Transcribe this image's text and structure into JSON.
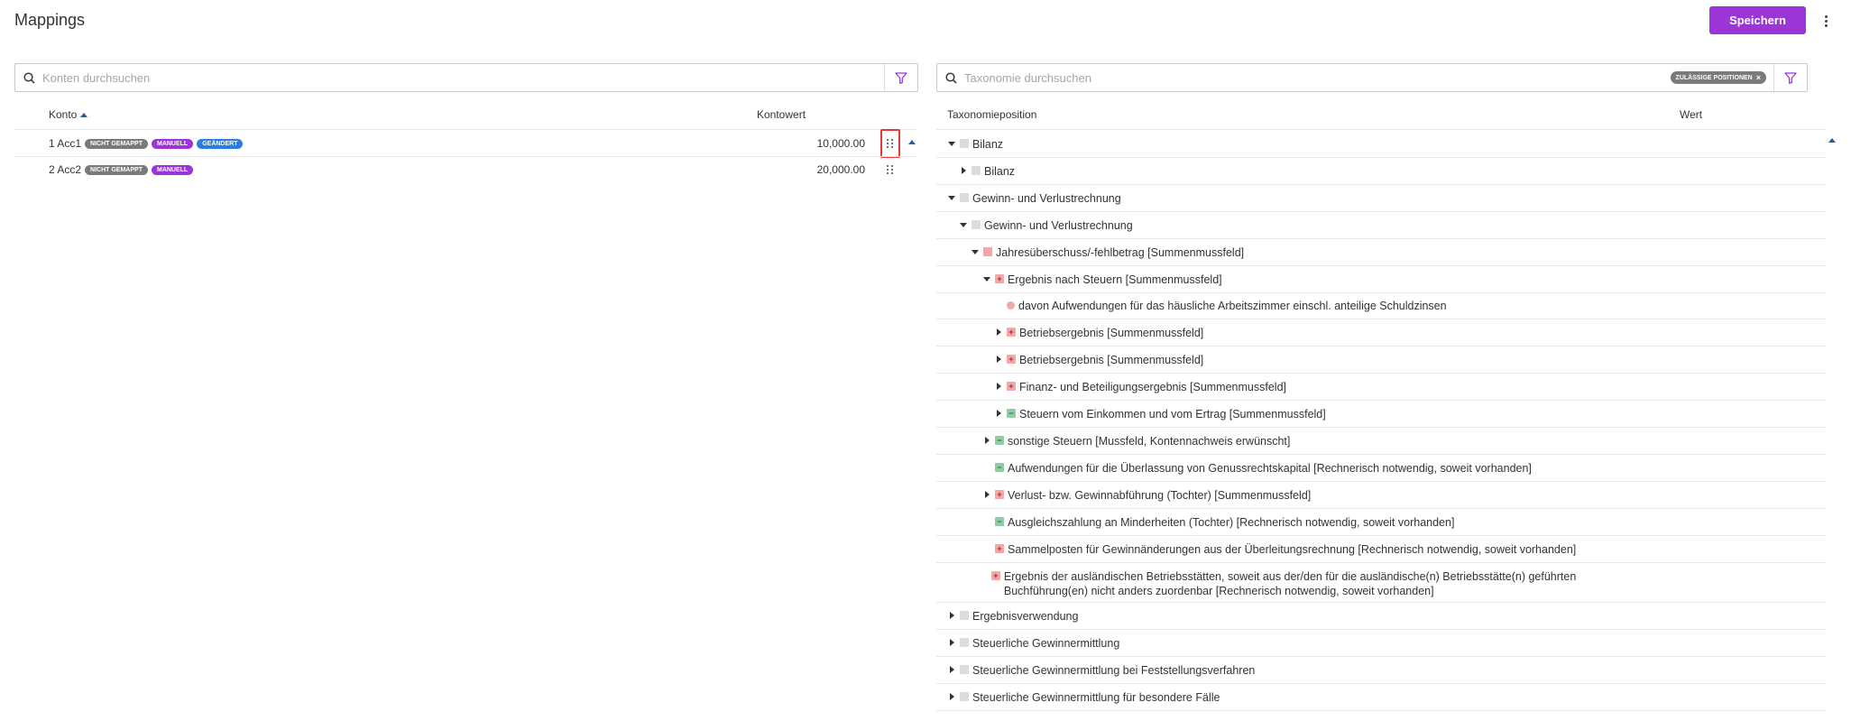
{
  "header": {
    "title": "Mappings",
    "save_label": "Speichern",
    "more_icon": "more-vertical-icon"
  },
  "colors": {
    "accent": "#9b35d8",
    "badge_grey": "#7a7a7a",
    "badge_blue": "#2b7de0",
    "highlight": "#e53935"
  },
  "accounts": {
    "search_placeholder": "Konten durchsuchen",
    "search_value": "",
    "columns": {
      "konto": "Konto",
      "kontowert": "Kontowert"
    },
    "sort": "ascending",
    "rows": [
      {
        "name": "1 Acc1",
        "badges": [
          "NICHT GEMAPPT",
          "MANUELL",
          "GEÄNDERT"
        ],
        "value": "10,000.00",
        "selected": true
      },
      {
        "name": "2 Acc2",
        "badges": [
          "NICHT GEMAPPT",
          "MANUELL"
        ],
        "value": "20,000.00",
        "selected": false
      }
    ]
  },
  "taxonomy": {
    "search_placeholder": "Taxonomie durchsuchen",
    "search_value": "",
    "filter_chip": "ZULÄSSIGE POSITIONEN",
    "columns": {
      "position": "Taxonomieposition",
      "wert": "Wert"
    },
    "rows": [
      {
        "label": "Bilanz",
        "level": 0,
        "toggle": "expanded",
        "marker": "grey"
      },
      {
        "label": "Bilanz",
        "level": 1,
        "toggle": "collapsed",
        "marker": "grey"
      },
      {
        "label": "Gewinn- und Verlustrechnung",
        "level": 0,
        "toggle": "expanded",
        "marker": "grey"
      },
      {
        "label": "Gewinn- und Verlustrechnung",
        "level": 1,
        "toggle": "expanded",
        "marker": "grey"
      },
      {
        "label": "Jahresüberschuss/-fehlbetrag [Summenmussfeld]",
        "level": 2,
        "toggle": "expanded",
        "marker": "pink"
      },
      {
        "label": "Ergebnis nach Steuern [Summenmussfeld]",
        "level": 3,
        "toggle": "expanded",
        "marker": "plus"
      },
      {
        "label": "davon Aufwendungen für das häusliche Arbeitszimmer einschl. anteilige Schuldzinsen",
        "level": 4,
        "toggle": "none",
        "marker": "circle"
      },
      {
        "label": "Betriebsergebnis [Summenmussfeld]",
        "level": 4,
        "toggle": "collapsed",
        "marker": "plus"
      },
      {
        "label": "Betriebsergebnis [Summenmussfeld]",
        "level": 4,
        "toggle": "collapsed",
        "marker": "plus"
      },
      {
        "label": "Finanz- und Beteiligungsergebnis [Summenmussfeld]",
        "level": 4,
        "toggle": "collapsed",
        "marker": "plus"
      },
      {
        "label": "Steuern vom Einkommen und vom Ertrag [Summenmussfeld]",
        "level": 4,
        "toggle": "collapsed",
        "marker": "minus"
      },
      {
        "label": "sonstige Steuern [Mussfeld, Kontennachweis erwünscht]",
        "level": 3,
        "toggle": "collapsed",
        "marker": "minus"
      },
      {
        "label": "Aufwendungen für die Überlassung von Genussrechtskapital [Rechnerisch notwendig, soweit vorhanden]",
        "level": 3,
        "toggle": "none",
        "marker": "minus"
      },
      {
        "label": "Verlust- bzw. Gewinnabführung (Tochter) [Summenmussfeld]",
        "level": 3,
        "toggle": "collapsed",
        "marker": "plus"
      },
      {
        "label": "Ausgleichszahlung an Minderheiten (Tochter) [Rechnerisch notwendig, soweit vorhanden]",
        "level": 3,
        "toggle": "none",
        "marker": "minus"
      },
      {
        "label": "Sammelposten für Gewinnänderungen aus der Überleitungsrechnung [Rechnerisch notwendig, soweit vorhanden]",
        "level": 3,
        "toggle": "none",
        "marker": "plus"
      },
      {
        "label": "Ergebnis der ausländischen Betriebsstätten, soweit aus der/den für die ausländische(n) Betriebsstätte(n) geführten Buchführung(en) nicht anders zuordenbar [Rechnerisch notwendig, soweit vorhanden]",
        "level": 3,
        "toggle": "none",
        "marker": "plus"
      },
      {
        "label": "Ergebnisverwendung",
        "level": 0,
        "toggle": "collapsed",
        "marker": "grey"
      },
      {
        "label": "Steuerliche Gewinnermittlung",
        "level": 0,
        "toggle": "collapsed",
        "marker": "grey"
      },
      {
        "label": "Steuerliche Gewinnermittlung bei Feststellungsverfahren",
        "level": 0,
        "toggle": "collapsed",
        "marker": "grey"
      },
      {
        "label": "Steuerliche Gewinnermittlung für besondere Fälle",
        "level": 0,
        "toggle": "collapsed",
        "marker": "grey"
      }
    ]
  }
}
